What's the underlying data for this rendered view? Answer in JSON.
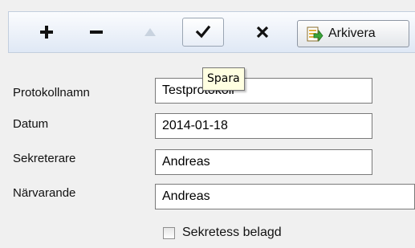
{
  "toolbar": {
    "add_icon": "plus-icon",
    "remove_icon": "minus-icon",
    "move_up_icon": "up-triangle-icon",
    "save_icon": "checkmark-icon",
    "cancel_icon": "x-icon",
    "archive_icon": "archive-arrow-icon",
    "archive_label": "Arkivera"
  },
  "tooltip": {
    "text": "Spara"
  },
  "form": {
    "fields": [
      {
        "label": "Protokollnamn",
        "value": "Testprotokoll"
      },
      {
        "label": "Datum",
        "value": "2014-01-18"
      },
      {
        "label": "Sekreterare",
        "value": "Andreas"
      },
      {
        "label": "Närvarande",
        "value": "Andreas"
      }
    ],
    "confidential": {
      "label": "Sekretess belagd",
      "checked": false
    }
  },
  "colors": {
    "toolbar_gradient_top": "#fbfcfe",
    "toolbar_gradient_bottom": "#dfe8f5",
    "tooltip_bg": "#ffffe1",
    "disabled_icon": "#c9d3df"
  }
}
